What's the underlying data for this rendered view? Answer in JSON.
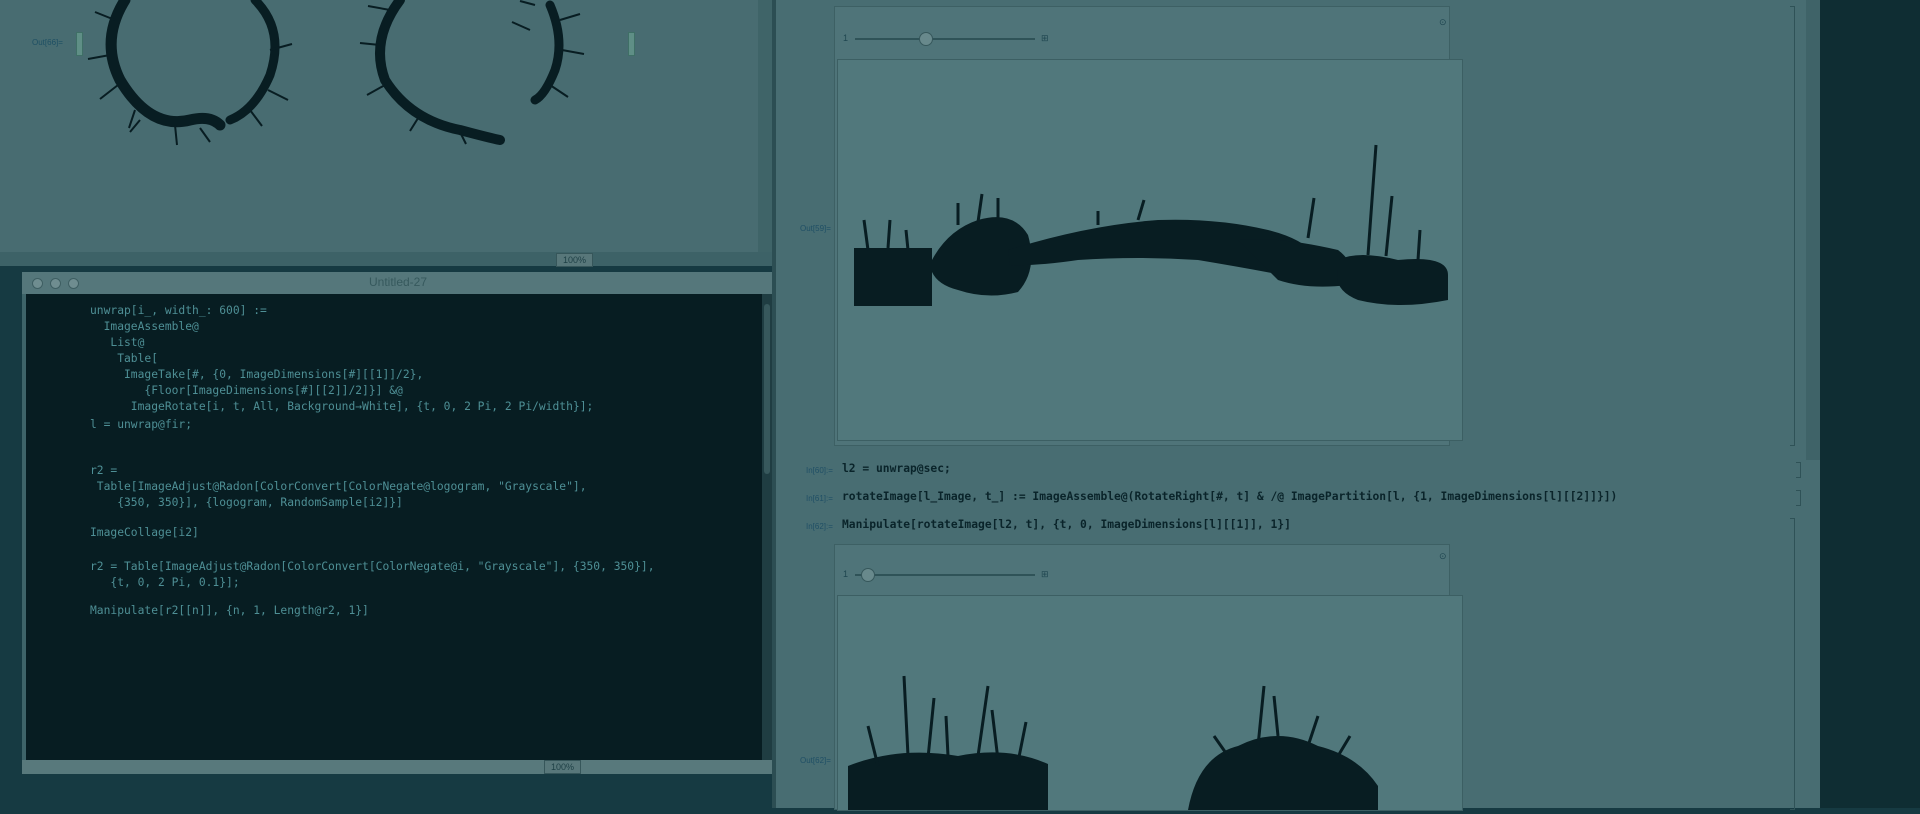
{
  "top_notebook": {
    "out_label": "Out[66]=",
    "zoom": "100%"
  },
  "editor": {
    "title": "Untitled-27",
    "zoom": "100%",
    "code_lines": [
      "unwrap[i_, width_: 600] :=",
      "  ImageAssemble@",
      "   List@",
      "    Table[",
      "     ImageTake[#, {0, ImageDimensions[#][[1]]/2},",
      "        {Floor[ImageDimensions[#][[2]]/2]}] &@",
      "      ImageRotate[i, t, All, Background→White], {t, 0, 2 Pi, 2 Pi/width}];",
      "l = unwrap@fir;",
      "r2 =",
      " Table[ImageAdjust@Radon[ColorConvert[ColorNegate@logogram, \"Grayscale\"],",
      "    {350, 350}], {logogram, RandomSample[i2]}]",
      "ImageCollage[i2]",
      "r2 = Table[ImageAdjust@Radon[ColorConvert[ColorNegate@i, \"Grayscale\"], {350, 350}],",
      "   {t, 0, 2 Pi, 0.1}];",
      "Manipulate[r2[[n]], {n, 1, Length@r2, 1}]"
    ]
  },
  "right_notebook": {
    "manipulate1": {
      "slider_min_label": "1",
      "out_label": "Out[59]="
    },
    "cells": [
      {
        "label": "In[60]:=",
        "code": "l2 = unwrap@sec;"
      },
      {
        "label": "In[61]:=",
        "code": "rotateImage[l_Image, t_] := ImageAssemble@(RotateRight[#, t] & /@ ImagePartition[l, {1, ImageDimensions[l][[2]]}])"
      },
      {
        "label": "In[62]:=",
        "code": "Manipulate[rotateImage[l2, t], {t, 0, ImageDimensions[l][[1]], 1}]"
      }
    ],
    "manipulate2": {
      "slider_min_label": "1",
      "out_label": "Out[62]="
    }
  },
  "colors": {
    "ink": "#081d22",
    "code_text": "#4e8f95",
    "notebook_bg": "#486d72"
  }
}
